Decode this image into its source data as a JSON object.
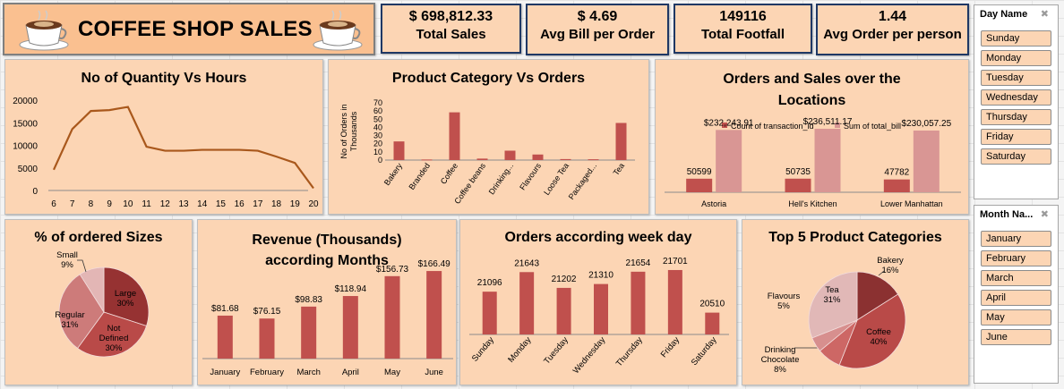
{
  "header": {
    "title": "COFFEE SHOP SALES"
  },
  "kpis": [
    {
      "value": "$ 698,812.33",
      "label": "Total Sales"
    },
    {
      "value": "$ 4.69",
      "label": "Avg Bill per Order"
    },
    {
      "value": "149116",
      "label": "Total Footfall"
    },
    {
      "value": "1.44",
      "label": "Avg Order per person"
    }
  ],
  "slicers": {
    "day": {
      "title": "Day Name",
      "items": [
        "Sunday",
        "Monday",
        "Tuesday",
        "Wednesday",
        "Thursday",
        "Friday",
        "Saturday"
      ]
    },
    "month": {
      "title": "Month Na...",
      "items": [
        "January",
        "February",
        "March",
        "April",
        "May",
        "June"
      ]
    }
  },
  "colors": {
    "bar": "#c0504d",
    "bar_light": "#d99694",
    "bar_dark": "#8b2c2c",
    "line": "#a9581c",
    "panel": "#fcd5b4"
  },
  "chart_data": [
    {
      "id": "qty_hours",
      "type": "line",
      "title": "No of Quantity Vs Hours",
      "x": [
        6,
        7,
        8,
        9,
        10,
        11,
        12,
        13,
        14,
        15,
        16,
        17,
        18,
        19,
        20
      ],
      "values": [
        4600,
        13600,
        17600,
        17800,
        18500,
        9700,
        8800,
        8800,
        9000,
        9000,
        9000,
        8800,
        7500,
        6100,
        500
      ],
      "yticks": [
        0,
        5000,
        10000,
        15000,
        20000
      ],
      "ylim": [
        0,
        20000
      ]
    },
    {
      "id": "cat_orders",
      "type": "bar",
      "title": "Product Category Vs Orders",
      "ylabel": "No of Orders in Thousands",
      "categories": [
        "Bakery",
        "Branded",
        "Coffee",
        "Coffee beans",
        "Drinking...",
        "Flavours",
        "Loose Tea",
        "Packaged...",
        "Tea"
      ],
      "values": [
        22.8,
        0.7,
        58.4,
        1.8,
        11.5,
        6.8,
        1.2,
        1.0,
        45.4
      ],
      "yticks": [
        0,
        10,
        20,
        30,
        40,
        50,
        60,
        70
      ],
      "ylim": [
        0,
        70
      ]
    },
    {
      "id": "locations",
      "type": "bar",
      "title": "Orders and Sales over the Locations",
      "categories": [
        "Astoria",
        "Hell's Kitchen",
        "Lower Manhattan"
      ],
      "series": [
        {
          "name": "Count of transaction_id",
          "values": [
            50599,
            50735,
            47782
          ],
          "labels": [
            "50599",
            "50735",
            "47782"
          ]
        },
        {
          "name": "Sum of total_bill",
          "values": [
            232243.91,
            236511.17,
            230057.25
          ],
          "labels": [
            "$232,243.91",
            "$236,511.17",
            "$230,057.25"
          ]
        }
      ]
    },
    {
      "id": "sizes",
      "type": "pie",
      "title": "% of ordered Sizes",
      "slices": [
        {
          "name": "Large",
          "pct": "30%",
          "value": 30,
          "color": "#963232"
        },
        {
          "name": "Not Defined",
          "pct": "30%",
          "value": 30,
          "color": "#b94a48"
        },
        {
          "name": "Regular",
          "pct": "31%",
          "value": 31,
          "color": "#cd7b7a"
        },
        {
          "name": "Small",
          "pct": "9%",
          "value": 9,
          "color": "#e3b6b5"
        }
      ]
    },
    {
      "id": "revenue_months",
      "type": "bar",
      "title": "Revenue (Thousands) according Months",
      "categories": [
        "January",
        "February",
        "March",
        "April",
        "May",
        "June"
      ],
      "values": [
        81.68,
        76.15,
        98.83,
        118.94,
        156.73,
        166.49
      ],
      "labels": [
        "$81.68",
        "$76.15",
        "$98.83",
        "$118.94",
        "$156.73",
        "$166.49"
      ]
    },
    {
      "id": "weekday",
      "type": "bar",
      "title": "Orders according week day",
      "categories": [
        "Sunday",
        "Monday",
        "Tuesday",
        "Wednesday",
        "Thursday",
        "Friday",
        "Saturday"
      ],
      "values": [
        21096,
        21643,
        21202,
        21310,
        21654,
        21701,
        20510
      ]
    },
    {
      "id": "top5",
      "type": "pie",
      "title": "Top 5 Product Categories",
      "slices": [
        {
          "name": "Bakery",
          "pct": "16%",
          "value": 16,
          "color": "#8b3131"
        },
        {
          "name": "Coffee",
          "pct": "40%",
          "value": 40,
          "color": "#b94a48"
        },
        {
          "name": "Drinking Chocolate",
          "pct": "8%",
          "value": 8,
          "color": "#cd6765"
        },
        {
          "name": "Flavours",
          "pct": "5%",
          "value": 5,
          "color": "#d78f8e"
        },
        {
          "name": "Tea",
          "pct": "31%",
          "value": 31,
          "color": "#e1b8b7"
        }
      ]
    }
  ]
}
